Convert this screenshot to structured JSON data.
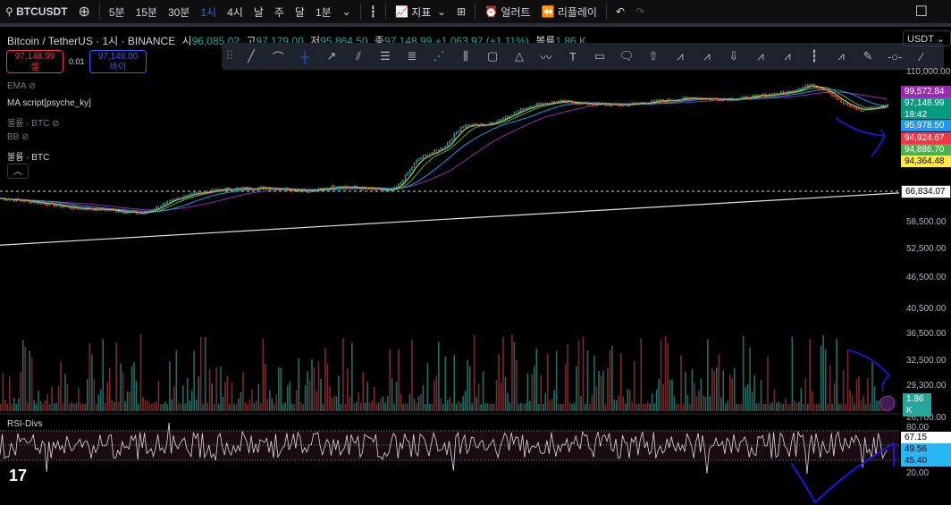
{
  "toolbar": {
    "symbol": "BTCUSDT",
    "intervals": [
      "5분",
      "15분",
      "30분",
      "1시",
      "4시",
      "날",
      "주",
      "달",
      "1분"
    ],
    "active_interval": "1시",
    "indicators": "지표",
    "alert": "얼러트",
    "replay": "리플레이"
  },
  "legend": {
    "title": "Bitcoin / TetherUS · 1시 · BINANCE",
    "open_label": "시",
    "open": "96,085.02",
    "high_label": "고",
    "high": "97,179.00",
    "low_label": "저",
    "low": "95,864.50",
    "close_label": "종",
    "close": "97,148.99",
    "change": "+1,063.97 (+1.11%)",
    "volume_label": "볼륨",
    "volume": "1.86 K"
  },
  "trade": {
    "sell_price": "97,148.99",
    "sell_label": "셀",
    "spread": "0.01",
    "buy_price": "97,149.00",
    "buy_label": "바이"
  },
  "indicators": [
    {
      "label": "EMA",
      "hidden": true
    },
    {
      "label": "MA script[psyche_ky]",
      "hidden": false
    },
    {
      "label": "볼륨 · BTC",
      "hidden": true
    },
    {
      "label": "BB",
      "hidden": true
    },
    {
      "label": "볼륨 · BTC",
      "hidden": false
    }
  ],
  "currency": "USDT",
  "price_scale": {
    "ticks": [
      "110,000.00",
      "58,500.00",
      "52,500.00",
      "46,500.00",
      "40,500.00",
      "36,500.00",
      "32,500.00",
      "29,300.00",
      "26,700.00"
    ],
    "tags": [
      {
        "value": "99,572.84",
        "color": "#9c27b0"
      },
      {
        "value": "97,148.99",
        "sub": "18:42",
        "color": "#089981"
      },
      {
        "value": "95,978.50",
        "color": "#2196f3"
      },
      {
        "value": "94,924.67",
        "color": "#f23645"
      },
      {
        "value": "94,886.70",
        "color": "#4caf50"
      },
      {
        "value": "94,364.48",
        "color": "#ffeb3b"
      }
    ],
    "dashed_level": "66,834.07",
    "volume_tag": "1.86 K"
  },
  "rsi": {
    "label": "RSI-Divs",
    "ticks": [
      "80.00",
      "20.00"
    ],
    "tags": [
      {
        "value": "67.15",
        "color": "#ffffff"
      },
      {
        "value": "49.56",
        "color": "#29b6f6"
      },
      {
        "value": "45.40",
        "color": "#29b6f6"
      }
    ]
  },
  "chart_data": {
    "type": "line",
    "price_points": [
      [
        0,
        64500
      ],
      [
        4,
        63500
      ],
      [
        8,
        62000
      ],
      [
        12,
        61500
      ],
      [
        16,
        60500
      ],
      [
        18,
        62500
      ],
      [
        21,
        65500
      ],
      [
        25,
        67000
      ],
      [
        30,
        67500
      ],
      [
        35,
        66500
      ],
      [
        38,
        68000
      ],
      [
        42,
        67000
      ],
      [
        44,
        66500
      ],
      [
        45,
        68500
      ],
      [
        47,
        76000
      ],
      [
        50,
        80000
      ],
      [
        52,
        87500
      ],
      [
        55,
        88000
      ],
      [
        57,
        91000
      ],
      [
        60,
        95500
      ],
      [
        63,
        97000
      ],
      [
        66,
        96000
      ],
      [
        70,
        95500
      ],
      [
        74,
        97000
      ],
      [
        78,
        98500
      ],
      [
        80,
        98000
      ],
      [
        83,
        98000
      ],
      [
        86,
        99500
      ],
      [
        89,
        101000
      ],
      [
        91,
        104000
      ],
      [
        93,
        102000
      ],
      [
        95,
        96000
      ],
      [
        97,
        93500
      ],
      [
        100,
        95500
      ]
    ],
    "long_ma": [
      53000,
      66000
    ]
  }
}
